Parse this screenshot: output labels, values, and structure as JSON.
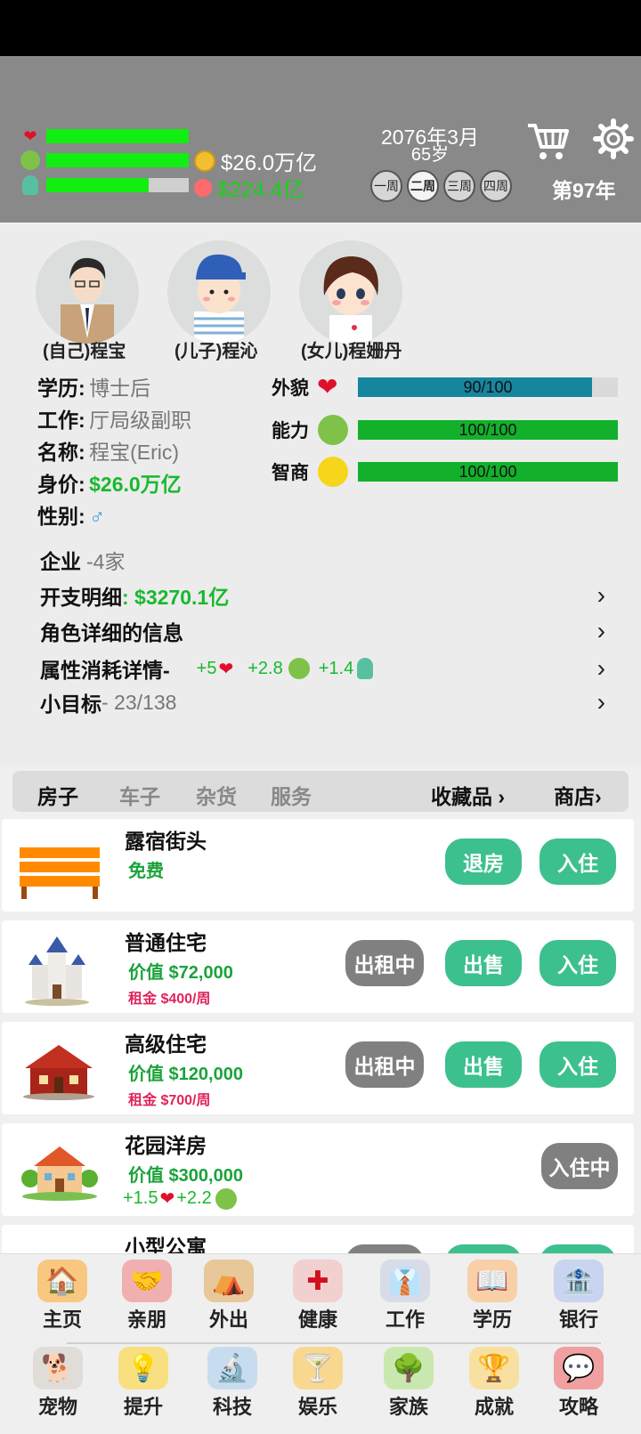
{
  "status": {
    "money": "$26.0万亿",
    "debt": "$224.4亿",
    "health_fill": 1.0,
    "ability_fill": 1.0,
    "iq_fill": 0.72,
    "date": "2076年3月",
    "age": "65岁",
    "weeks": [
      "一周",
      "二周",
      "三周",
      "四周"
    ],
    "active_week": 1,
    "year_label": "第97年"
  },
  "family": [
    {
      "name": "(自己)程宝"
    },
    {
      "name": "(儿子)程沁"
    },
    {
      "name": "(女儿)程姗丹"
    }
  ],
  "profile": {
    "education_label": "学历:",
    "education": "博士后",
    "job_label": "工作:",
    "job": "厅局级副职",
    "name_label": "名称:",
    "name": "程宝(Eric)",
    "worth_label": "身价:",
    "worth": "$26.0万亿",
    "gender_label": "性别:",
    "gender": "♂"
  },
  "attributes": [
    {
      "label": "外貌",
      "text": "90/100",
      "value": 90,
      "color": "#16869e"
    },
    {
      "label": "能力",
      "text": "100/100",
      "value": 100,
      "color": "#13b02c"
    },
    {
      "label": "智商",
      "text": "100/100",
      "value": 100,
      "color": "#13b02c"
    }
  ],
  "details": {
    "company_label": "企业",
    "company_value": "-4家",
    "expense_label": "开支明细",
    "expense_value": ": $3270.1亿",
    "role_info": "角色详细的信息",
    "consume_label": "属性消耗详情-",
    "consume_health": "+5",
    "consume_ability": "+2.8",
    "consume_iq": "+1.4",
    "goal_label": "小目标",
    "goal_value": "- 23/138"
  },
  "tabs": {
    "house": "房子",
    "car": "车子",
    "goods": "杂货",
    "service": "服务",
    "collection": "收藏品",
    "shop": "商店"
  },
  "houses": [
    {
      "title": "露宿街头",
      "line1": "免费",
      "line2": "",
      "btn_rent": "",
      "btn_sell": "退房",
      "btn_live": "入住"
    },
    {
      "title": "普通住宅",
      "line1": "价值 $72,000",
      "line2": "租金 $400/周",
      "btn_rent": "出租中",
      "btn_sell": "出售",
      "btn_live": "入住"
    },
    {
      "title": "高级住宅",
      "line1": "价值 $120,000",
      "line2": "租金 $700/周",
      "btn_rent": "出租中",
      "btn_sell": "出售",
      "btn_live": "入住"
    },
    {
      "title": "花园洋房",
      "line1": "价值 $300,000",
      "bonus_health": "+1.5",
      "bonus_ability": "+2.2",
      "btn_live": "入住中"
    },
    {
      "title": "小型公寓"
    }
  ],
  "nav": {
    "row1": [
      "主页",
      "亲朋",
      "外出",
      "健康",
      "工作",
      "学历",
      "银行"
    ],
    "row2": [
      "宠物",
      "提升",
      "科技",
      "娱乐",
      "家族",
      "成就",
      "攻略"
    ]
  }
}
